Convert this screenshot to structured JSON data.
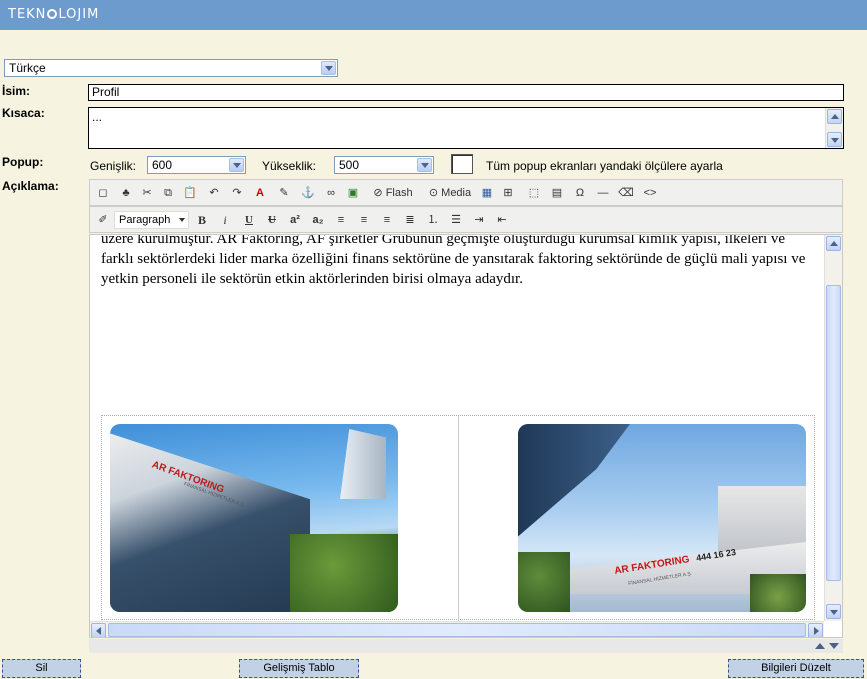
{
  "brand": {
    "text": "TEKN",
    "text_o": "LOJIM"
  },
  "language": {
    "selected": "Türkçe"
  },
  "labels": {
    "isim": "İsim:",
    "kisaca": "Kısaca:",
    "popup": "Popup:",
    "aciklama": "Açıklama:"
  },
  "isim_value": "Profil",
  "kisaca_value": "...",
  "popup": {
    "genislik_label": "Genişlik:",
    "genislik_value": "600",
    "yukseklik_label": "Yükseklik:",
    "yukseklik_value": "500",
    "apply_all_label": "Tüm popup ekranları yandaki ölçülere ayarla"
  },
  "toolbar": {
    "flash": "Flash",
    "media": "Media",
    "format_value": "Paragraph",
    "bold": "B",
    "italic": "i",
    "underline": "U",
    "strike": "U",
    "superscript": "a²",
    "subscript": "a₂",
    "omega": "Ω",
    "code": "<>"
  },
  "editor": {
    "paragraph": "üzere kurulmuştur. AR Faktoring, AF şirketler Grubunun geçmişte oluşturduğu kurumsal kimlik yapısı, ilkeleri ve farklı sektörlerdeki lider marka özelliğini finans sektörüne de yansıtarak faktoring sektöründe de güçlü mali yapısı ve yetkin personeli ile sektörün etkin aktörlerinden birisi olmaya adaydır.",
    "photo1_sign": "AR FAKTORING",
    "photo1_sub": "FİNANSAL HİZMETLER A.Ş.",
    "photo2_sign": "AR FAKTORING",
    "photo2_phone": "444 16 23",
    "photo2_sub": "FİNANSAL HİZMETLER A.Ş."
  },
  "buttons": {
    "delete": "Sil",
    "advanced_table": "Gelişmiş Tablo",
    "save": "Bilgileri Düzelt"
  }
}
